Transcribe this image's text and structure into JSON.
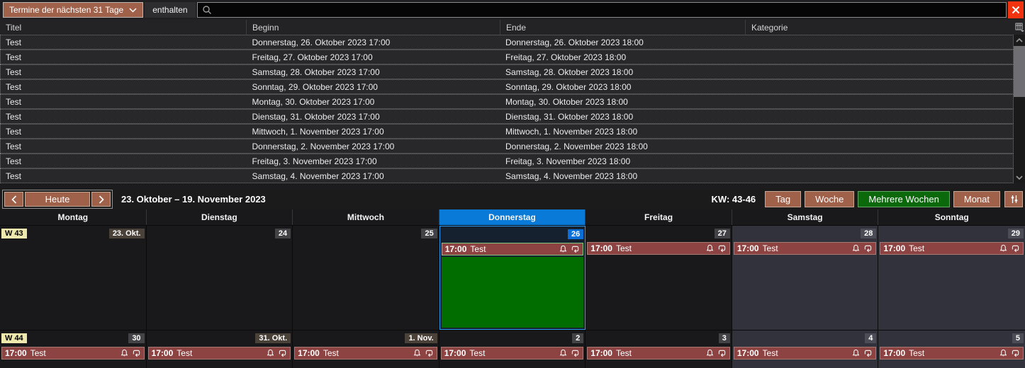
{
  "filter_bar": {
    "dropdown_label": "Termine der nächsten 31 Tage",
    "match_label": "enthalten",
    "search_value": ""
  },
  "table": {
    "columns": [
      "Titel",
      "Beginn",
      "Ende",
      "Kategorie"
    ],
    "rows": [
      {
        "titel": "Test",
        "beginn": "Donnerstag, 26. Oktober 2023 17:00",
        "ende": "Donnerstag, 26. Oktober 2023 18:00",
        "kategorie": ""
      },
      {
        "titel": "Test",
        "beginn": "Freitag, 27. Oktober 2023 17:00",
        "ende": "Freitag, 27. Oktober 2023 18:00",
        "kategorie": ""
      },
      {
        "titel": "Test",
        "beginn": "Samstag, 28. Oktober 2023 17:00",
        "ende": "Samstag, 28. Oktober 2023 18:00",
        "kategorie": ""
      },
      {
        "titel": "Test",
        "beginn": "Sonntag, 29. Oktober 2023 17:00",
        "ende": "Sonntag, 29. Oktober 2023 18:00",
        "kategorie": ""
      },
      {
        "titel": "Test",
        "beginn": "Montag, 30. Oktober 2023 17:00",
        "ende": "Montag, 30. Oktober 2023 18:00",
        "kategorie": ""
      },
      {
        "titel": "Test",
        "beginn": "Dienstag, 31. Oktober 2023 17:00",
        "ende": "Dienstag, 31. Oktober 2023 18:00",
        "kategorie": ""
      },
      {
        "titel": "Test",
        "beginn": "Mittwoch, 1. November 2023 17:00",
        "ende": "Mittwoch, 1. November 2023 18:00",
        "kategorie": ""
      },
      {
        "titel": "Test",
        "beginn": "Donnerstag, 2. November 2023 17:00",
        "ende": "Donnerstag, 2. November 2023 18:00",
        "kategorie": ""
      },
      {
        "titel": "Test",
        "beginn": "Freitag, 3. November 2023 17:00",
        "ende": "Freitag, 3. November 2023 18:00",
        "kategorie": ""
      },
      {
        "titel": "Test",
        "beginn": "Samstag, 4. November 2023 17:00",
        "ende": "Samstag, 4. November 2023 18:00",
        "kategorie": ""
      }
    ]
  },
  "calendar_toolbar": {
    "today_label": "Heute",
    "range_title": "23. Oktober – 19. November 2023",
    "week_numbers": "KW: 43-46",
    "views": [
      {
        "label": "Tag",
        "active": false
      },
      {
        "label": "Woche",
        "active": false
      },
      {
        "label": "Mehrere Wochen",
        "active": true
      },
      {
        "label": "Monat",
        "active": false
      }
    ]
  },
  "calendar": {
    "day_headers": [
      {
        "label": "Montag",
        "highlight": false
      },
      {
        "label": "Dienstag",
        "highlight": false
      },
      {
        "label": "Mittwoch",
        "highlight": false
      },
      {
        "label": "Donnerstag",
        "highlight": true
      },
      {
        "label": "Freitag",
        "highlight": false
      },
      {
        "label": "Samstag",
        "highlight": false
      },
      {
        "label": "Sonntag",
        "highlight": false
      }
    ],
    "weeks": [
      {
        "week_label": "W 43",
        "days": [
          {
            "date": "23. Okt.",
            "weekend": false,
            "today": false,
            "event": null
          },
          {
            "date": "24",
            "weekend": false,
            "today": false,
            "event": null
          },
          {
            "date": "25",
            "weekend": false,
            "today": false,
            "event": null
          },
          {
            "date": "26",
            "weekend": false,
            "today": true,
            "event": {
              "time": "17:00",
              "title": "Test",
              "selected": true
            }
          },
          {
            "date": "27",
            "weekend": false,
            "today": false,
            "event": {
              "time": "17:00",
              "title": "Test",
              "selected": false
            }
          },
          {
            "date": "28",
            "weekend": true,
            "today": false,
            "event": {
              "time": "17:00",
              "title": "Test",
              "selected": false
            }
          },
          {
            "date": "29",
            "weekend": true,
            "today": false,
            "event": {
              "time": "17:00",
              "title": "Test",
              "selected": false
            }
          }
        ]
      },
      {
        "week_label": "W 44",
        "days": [
          {
            "date": "30",
            "weekend": false,
            "today": false,
            "event": {
              "time": "17:00",
              "title": "Test",
              "selected": false
            }
          },
          {
            "date": "31. Okt.",
            "weekend": false,
            "today": false,
            "event": {
              "time": "17:00",
              "title": "Test",
              "selected": false
            }
          },
          {
            "date": "1. Nov.",
            "weekend": false,
            "today": false,
            "event": {
              "time": "17:00",
              "title": "Test",
              "selected": false
            }
          },
          {
            "date": "2",
            "weekend": false,
            "today": false,
            "event": {
              "time": "17:00",
              "title": "Test",
              "selected": false
            }
          },
          {
            "date": "3",
            "weekend": false,
            "today": false,
            "event": {
              "time": "17:00",
              "title": "Test",
              "selected": false
            }
          },
          {
            "date": "4",
            "weekend": true,
            "today": false,
            "event": {
              "time": "17:00",
              "title": "Test",
              "selected": false
            }
          },
          {
            "date": "5",
            "weekend": true,
            "today": false,
            "event": {
              "time": "17:00",
              "title": "Test",
              "selected": false
            }
          }
        ]
      }
    ]
  },
  "colors": {
    "accent_brown": "#a0614b",
    "active_view_green": "#0b680b",
    "event_red": "#8e4343",
    "today_blue": "#0a7ad9",
    "today_cell_green": "#016d01",
    "week_badge_yellow": "#efe9ae",
    "close_red": "#f23310"
  }
}
